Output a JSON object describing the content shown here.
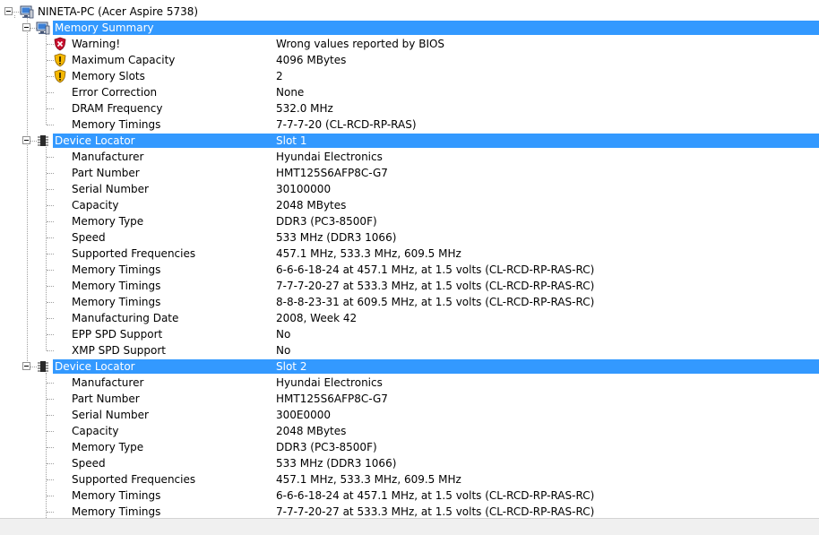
{
  "root": {
    "label": "NINETA-PC (Acer Aspire 5738)"
  },
  "memory_summary": {
    "label": "Memory Summary",
    "items": [
      {
        "label": "Warning!",
        "value": "Wrong values reported by BIOS",
        "icon": "error-shield-icon"
      },
      {
        "label": "Maximum Capacity",
        "value": "4096 MBytes",
        "icon": "warning-shield-icon"
      },
      {
        "label": "Memory Slots",
        "value": "2",
        "icon": "warning-shield-icon"
      },
      {
        "label": "Error Correction",
        "value": "None"
      },
      {
        "label": "DRAM Frequency",
        "value": "532.0 MHz"
      },
      {
        "label": "Memory Timings",
        "value": "7-7-7-20 (CL-RCD-RP-RAS)"
      }
    ]
  },
  "devices": [
    {
      "label": "Device Locator",
      "value": "Slot 1",
      "items": [
        {
          "label": "Manufacturer",
          "value": "Hyundai Electronics"
        },
        {
          "label": "Part Number",
          "value": "HMT125S6AFP8C-G7"
        },
        {
          "label": "Serial Number",
          "value": "30100000"
        },
        {
          "label": "Capacity",
          "value": "2048 MBytes"
        },
        {
          "label": "Memory Type",
          "value": "DDR3 (PC3-8500F)"
        },
        {
          "label": "Speed",
          "value": "533 MHz (DDR3 1066)"
        },
        {
          "label": "Supported Frequencies",
          "value": "457.1 MHz, 533.3 MHz, 609.5 MHz"
        },
        {
          "label": "Memory Timings",
          "value": "6-6-6-18-24 at 457.1 MHz, at 1.5 volts (CL-RCD-RP-RAS-RC)"
        },
        {
          "label": "Memory Timings",
          "value": "7-7-7-20-27 at 533.3 MHz, at 1.5 volts (CL-RCD-RP-RAS-RC)"
        },
        {
          "label": "Memory Timings",
          "value": "8-8-8-23-31 at 609.5 MHz, at 1.5 volts (CL-RCD-RP-RAS-RC)"
        },
        {
          "label": "Manufacturing Date",
          "value": "2008, Week 42"
        },
        {
          "label": "EPP SPD Support",
          "value": "No"
        },
        {
          "label": "XMP SPD Support",
          "value": "No"
        }
      ]
    },
    {
      "label": "Device Locator",
      "value": "Slot 2",
      "items": [
        {
          "label": "Manufacturer",
          "value": "Hyundai Electronics"
        },
        {
          "label": "Part Number",
          "value": "HMT125S6AFP8C-G7"
        },
        {
          "label": "Serial Number",
          "value": "300E0000"
        },
        {
          "label": "Capacity",
          "value": "2048 MBytes"
        },
        {
          "label": "Memory Type",
          "value": "DDR3 (PC3-8500F)"
        },
        {
          "label": "Speed",
          "value": "533 MHz (DDR3 1066)"
        },
        {
          "label": "Supported Frequencies",
          "value": "457.1 MHz, 533.3 MHz, 609.5 MHz"
        },
        {
          "label": "Memory Timings",
          "value": "6-6-6-18-24 at 457.1 MHz, at 1.5 volts (CL-RCD-RP-RAS-RC)"
        },
        {
          "label": "Memory Timings",
          "value": "7-7-7-20-27 at 533.3 MHz, at 1.5 volts (CL-RCD-RP-RAS-RC)"
        }
      ]
    }
  ],
  "colors": {
    "selection": "#3399ff",
    "tree_lines": "#a0a0a0",
    "statusbar": "#f0f0f0"
  }
}
